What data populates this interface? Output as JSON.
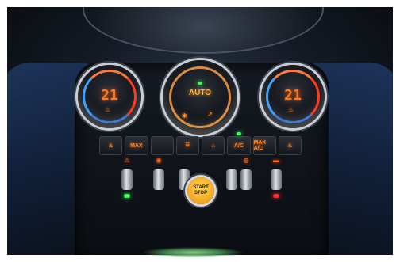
{
  "climate": {
    "left_temp": "21",
    "right_temp": "21",
    "center_mode": "AUTO"
  },
  "buttons": [
    {
      "label": "♨",
      "icon": "seat-heat-left-icon"
    },
    {
      "label": "MAX",
      "icon": "max-defrost-icon"
    },
    {
      "label": "",
      "icon": "blank-button-icon"
    },
    {
      "label": "⌸",
      "icon": "rear-defrost-icon"
    },
    {
      "label": "⌂",
      "icon": "recirculation-icon"
    },
    {
      "label": "A/C",
      "icon": "ac-icon",
      "led": true
    },
    {
      "label": "MAX A/C",
      "icon": "max-ac-icon"
    },
    {
      "label": "♨",
      "icon": "seat-heat-right-icon"
    }
  ],
  "toggles": [
    {
      "label": "⚠",
      "icon": "hazard-icon",
      "glow": "#33ff55"
    },
    {
      "label": "◉",
      "icon": "tire-pressure-icon",
      "glow": ""
    },
    {
      "label": "",
      "icon": "blank-toggle-icon",
      "glow": ""
    },
    {
      "label": "",
      "icon": "blank-toggle-icon",
      "glow": ""
    },
    {
      "label": "◍",
      "icon": "lamp-icon",
      "glow": ""
    },
    {
      "label": "▬",
      "icon": "window-icon",
      "glow": "#ff2a2a"
    }
  ],
  "start": {
    "label": "START\nSTOP"
  }
}
